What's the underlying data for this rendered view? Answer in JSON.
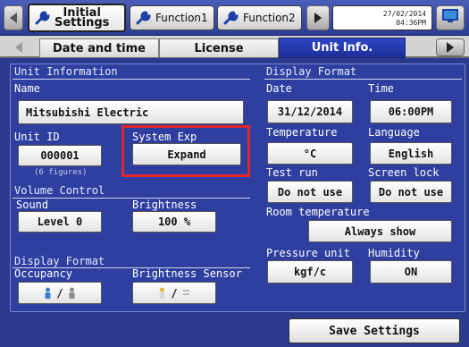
{
  "topbar": {
    "tabs": [
      {
        "label_line1": "Initial",
        "label_line2": "Settings",
        "icon": "wrench-icon",
        "active": true
      },
      {
        "label": "Function1",
        "icon": "wrench-icon"
      },
      {
        "label": "Function2",
        "icon": "wrench-icon"
      }
    ],
    "datetime_line1": "27/02/2014",
    "datetime_line2": "04:36PM",
    "monitor_icon": "monitor-icon"
  },
  "subtabs": [
    "Date and time",
    "License",
    "Unit Info."
  ],
  "unit_information": {
    "heading": "Unit Information",
    "name_label": "Name",
    "name_value": "Mitsubishi Electric",
    "unit_id_label": "Unit ID",
    "unit_id_value": "000001",
    "unit_id_hint": "(6 figures)",
    "system_exp_label": "System Exp",
    "system_exp_value": "Expand"
  },
  "volume_control": {
    "heading": "Volume Control",
    "sound_label": "Sound",
    "sound_value": "Level 0",
    "brightness_label": "Brightness",
    "brightness_value": "100 %"
  },
  "display_format_left": {
    "heading": "Display Format",
    "occupancy_label": "Occupancy",
    "brightness_sensor_label": "Brightness Sensor",
    "occupancy_sep": "/",
    "brightness_sensor_sep": "/"
  },
  "display_format_right": {
    "heading": "Display Format",
    "date_label": "Date",
    "date_value": "31/12/2014",
    "time_label": "Time",
    "time_value": "06:00PM",
    "temperature_label": "Temperature",
    "temperature_value": "°C",
    "language_label": "Language",
    "language_value": "English",
    "test_run_label": "Test run",
    "test_run_value": "Do not use",
    "screen_lock_label": "Screen lock",
    "screen_lock_value": "Do not use",
    "room_temp_label": "Room temperature",
    "room_temp_value": "Always show",
    "pressure_unit_label": "Pressure unit",
    "pressure_unit_value": "kgf/c",
    "humidity_label": "Humidity",
    "humidity_value": "ON"
  },
  "save_button": "Save Settings",
  "colors": {
    "accent": "#2e3fa0",
    "highlight": "#e0262b",
    "active_tab": "#1d2f9c"
  }
}
